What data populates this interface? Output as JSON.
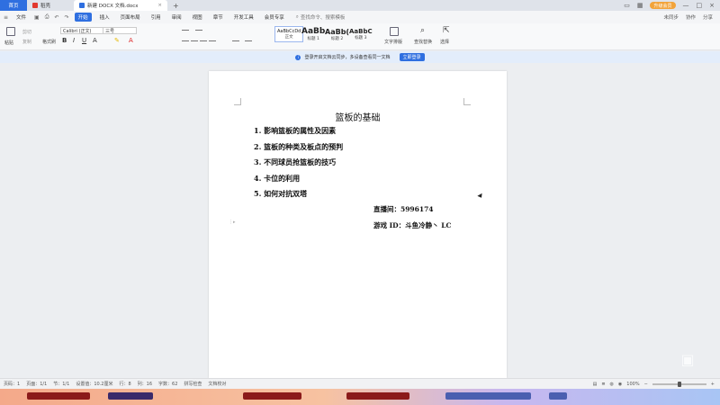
{
  "tabs": {
    "home": "首页",
    "mine": "稻壳",
    "doc": "新建 DOCX 文档.docx"
  },
  "titlebar": {
    "vip_label": "升级会员"
  },
  "menu": {
    "file": "文件",
    "items": [
      "开始",
      "插入",
      "页面布局",
      "引用",
      "审阅",
      "视图",
      "章节",
      "开发工具",
      "会员专享"
    ],
    "search_placeholder": "查找命令、搜索模板",
    "right": [
      "未同步",
      "协作",
      "分享"
    ]
  },
  "ribbon": {
    "paste": "粘贴",
    "cut": "剪切",
    "copy": "复制",
    "format_painter": "格式刷",
    "font_name": "Calibri (正文)",
    "font_size": "三号",
    "styles": [
      {
        "sample": "AaBbCcDd",
        "label": "正文"
      },
      {
        "sample": "AaBb",
        "label": "标题 1"
      },
      {
        "sample": "AaBb(",
        "label": "标题 2"
      },
      {
        "sample": "AaBbC",
        "label": "标题 3"
      }
    ],
    "text_tools": "文字排版",
    "find_replace": "查找替换",
    "select": "选择"
  },
  "notice": {
    "text": "登录开启文档云同步，多设备查看同一文档",
    "button": "立即登录"
  },
  "document": {
    "title": "篮板的基础",
    "items": [
      "1. 影响篮板的属性及因素",
      "2. 篮板的种类及板点的预判",
      "3. 不同球员抢篮板的技巧",
      "4. 卡位的利用",
      "5. 如何对抗双塔"
    ],
    "live_room": "直播间：5996174",
    "game_id": "游戏 ID：斗鱼冷静丶 LC"
  },
  "status": {
    "page_num": "页码：1",
    "pages": "页面：1/1",
    "section": "节：1/1",
    "setting": "设置值：10.2厘米",
    "row": "行：8",
    "col": "列：16",
    "words": "字数：62",
    "spell": "拼写检查",
    "proofread": "文档校对",
    "zoom": "100%"
  },
  "colors": {
    "accent": "#2f6fe0",
    "vip": "#f2a33a"
  }
}
